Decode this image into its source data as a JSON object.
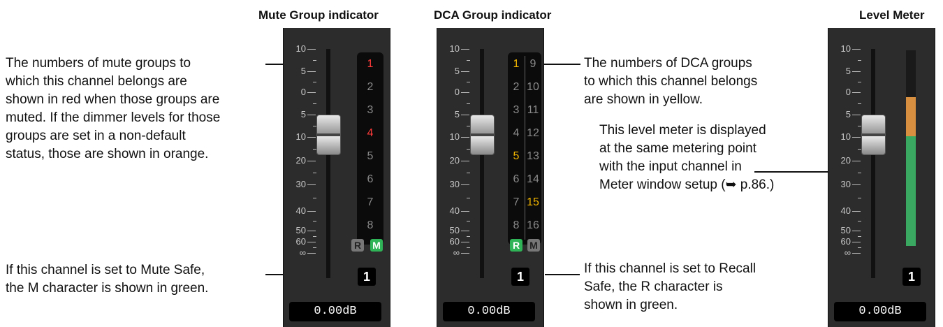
{
  "titles": {
    "mute": "Mute Group indicator",
    "dca": "DCA Group indicator",
    "meter": "Level Meter"
  },
  "scale_labels": [
    "10",
    "5",
    "0",
    "5",
    "10",
    "20",
    "30",
    "40",
    "50",
    "60",
    "∞"
  ],
  "db_value": "0.00dB",
  "channel_number": "1",
  "mute_panel": {
    "groups": [
      "1",
      "2",
      "3",
      "4",
      "5",
      "6",
      "7",
      "8"
    ],
    "active_red": [
      "1",
      "4"
    ],
    "badge_r": "R",
    "badge_m": "M"
  },
  "dca_panel": {
    "left_col": [
      "1",
      "2",
      "3",
      "4",
      "5",
      "6",
      "7",
      "8"
    ],
    "right_col": [
      "9",
      "10",
      "11",
      "12",
      "13",
      "14",
      "15",
      "16"
    ],
    "active_yellow": [
      "1",
      "5",
      "15"
    ],
    "badge_r": "R",
    "badge_m": "M"
  },
  "meter_panel": {
    "level_fraction": 0.76,
    "orange_fraction": 0.2
  },
  "annotations": {
    "mute_groups": [
      "The numbers of mute groups to",
      "which this channel belongs are",
      "shown in red when those groups are",
      "muted. If the dimmer levels for those",
      "groups are set in a non-default",
      "status, those are shown in orange."
    ],
    "mute_safe": [
      "If this channel is set to Mute Safe,",
      "the M character is shown in green."
    ],
    "dca_groups": [
      "The numbers of DCA groups",
      "to which this channel belongs",
      "are shown in yellow."
    ],
    "recall_safe": [
      "If this channel is set to Recall",
      "Safe, the R character is",
      "shown in green."
    ],
    "level_meter": [
      "This level meter is displayed",
      "at the same metering point",
      "with the input channel in",
      "Meter window setup (➥ p.86.)"
    ]
  },
  "colors": {
    "red": "#ff3a3a",
    "yellow": "#f5b800",
    "gray": "#8a8a8a",
    "green": "#2fb457",
    "meter_green": "#3aa860",
    "meter_orange": "#d89040"
  }
}
